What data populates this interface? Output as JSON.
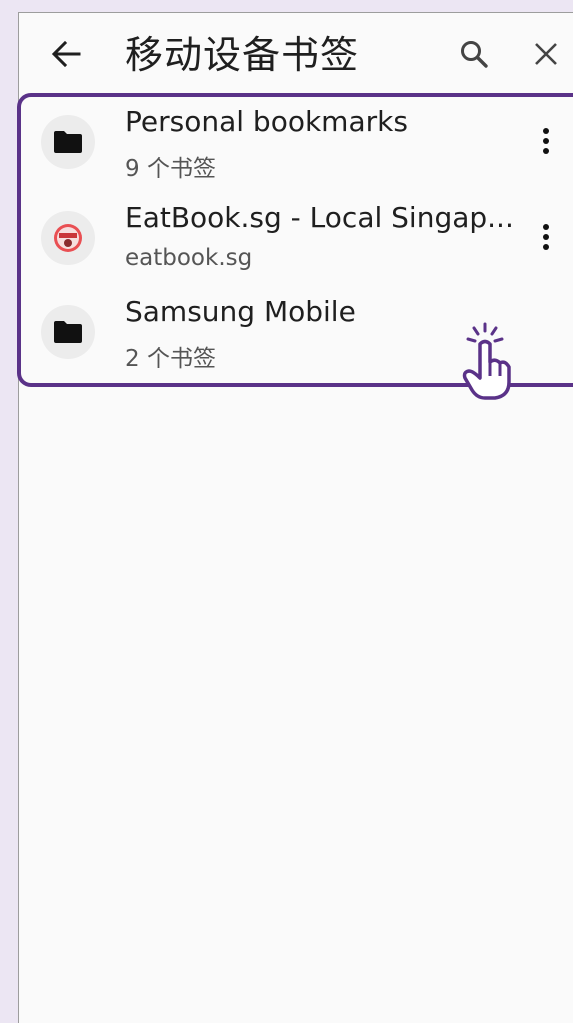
{
  "header": {
    "title": "移动设备书签",
    "back_icon": "arrow-left-icon",
    "search_icon": "search-icon",
    "close_icon": "close-icon"
  },
  "items": [
    {
      "title": "Personal bookmarks",
      "subtitle": "9 个书签",
      "icon": "folder-icon",
      "has_menu": true
    },
    {
      "title": "EatBook.sg - Local Singap...",
      "subtitle": "eatbook.sg",
      "icon": "site-favicon",
      "has_menu": true
    },
    {
      "title": "Samsung Mobile",
      "subtitle": "2 个书签",
      "icon": "folder-icon",
      "has_menu": false
    }
  ],
  "colors": {
    "highlight": "#5a3288",
    "background": "#fafafa",
    "page_bg": "#ece6f3"
  },
  "annotation": {
    "icon": "tap-hand-icon"
  }
}
